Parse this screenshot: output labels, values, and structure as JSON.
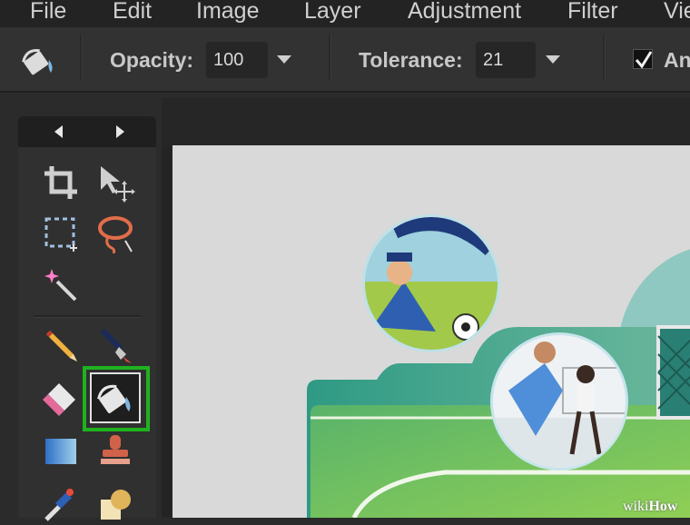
{
  "menu": {
    "items": [
      "File",
      "Edit",
      "Image",
      "Layer",
      "Adjustment",
      "Filter",
      "Vie"
    ]
  },
  "options": {
    "tool_icon": "paint-bucket-icon",
    "opacity_label": "Opacity:",
    "opacity_value": "100",
    "tolerance_label": "Tolerance:",
    "tolerance_value": "21",
    "antialias_checked": true,
    "antialias_label": "An"
  },
  "tools": {
    "nav": [
      "previous-arrow-icon",
      "next-arrow-icon"
    ],
    "items": [
      "crop-icon",
      "move-icon",
      "marquee-select-icon",
      "lasso-icon",
      "magic-wand-icon",
      "pencil-icon",
      "brush-icon",
      "eraser-icon",
      "paint-bucket-icon",
      "gradient-icon",
      "clone-stamp-icon",
      "color-replace-icon",
      "shape-icon"
    ],
    "selected": "paint-bucket-icon"
  },
  "colors": {
    "highlight": "#1fb21f",
    "panel": "#303030",
    "canvas_bg": "#d9d9d9"
  },
  "watermark": {
    "prefix": "wiki",
    "suffix": "How"
  }
}
